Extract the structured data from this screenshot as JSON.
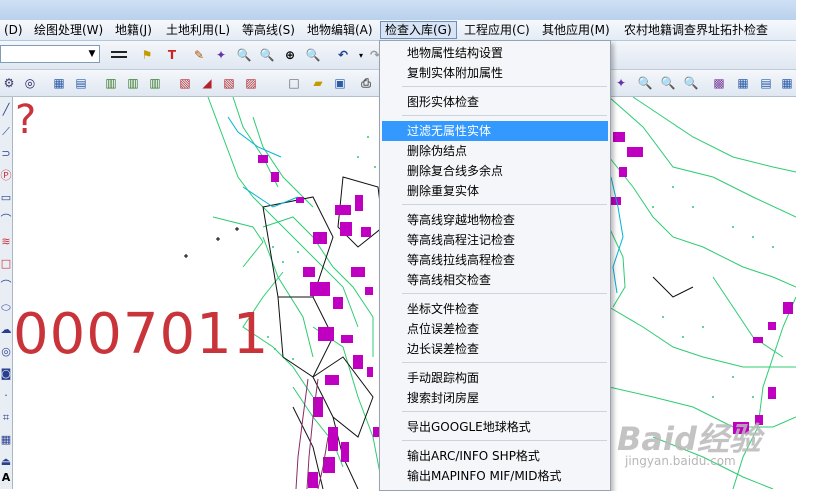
{
  "menubar": {
    "items": [
      {
        "label": "(D)"
      },
      {
        "label": "绘图处理(W)"
      },
      {
        "label": "地籍(J)"
      },
      {
        "label": "土地利用(L)"
      },
      {
        "label": "等高线(S)"
      },
      {
        "label": "地物编辑(A)"
      },
      {
        "label": "检查入库(G)"
      },
      {
        "label": "工程应用(C)"
      },
      {
        "label": "其他应用(M)"
      },
      {
        "label": "农村地籍调查界址拓扑检查"
      }
    ]
  },
  "dropdown": {
    "items": [
      {
        "label": "地物属性结构设置"
      },
      {
        "label": "复制实体附加属性"
      },
      {
        "label": "图形实体检查"
      },
      {
        "label": "过滤无属性实体"
      },
      {
        "label": "删除伪结点"
      },
      {
        "label": "删除复合线多余点"
      },
      {
        "label": "删除重复实体"
      },
      {
        "label": "等高线穿越地物检查"
      },
      {
        "label": "等高线高程注记检查"
      },
      {
        "label": "等高线拉线高程检查"
      },
      {
        "label": "等高线相交检查"
      },
      {
        "label": "坐标文件检查"
      },
      {
        "label": "点位误差检查"
      },
      {
        "label": "边长误差检查"
      },
      {
        "label": "手动跟踪构面"
      },
      {
        "label": "搜索封闭房屋"
      },
      {
        "label": "导出GOOGLE地球格式"
      },
      {
        "label": "输出ARC/INFO SHP格式"
      },
      {
        "label": "输出MAPINFO MIF/MID格式"
      }
    ]
  },
  "canvas": {
    "big_number": "0007011",
    "question_mark": "?"
  },
  "left_toolbar": {
    "last_tool": "A"
  },
  "watermark": {
    "logo": "Baid经验",
    "url": "jingyan.baidu.com"
  },
  "colors": {
    "highlight": "#3399ff",
    "map_green": "#2ecc71",
    "map_magenta": "#c000c0",
    "annotation_red": "#c8343a"
  }
}
